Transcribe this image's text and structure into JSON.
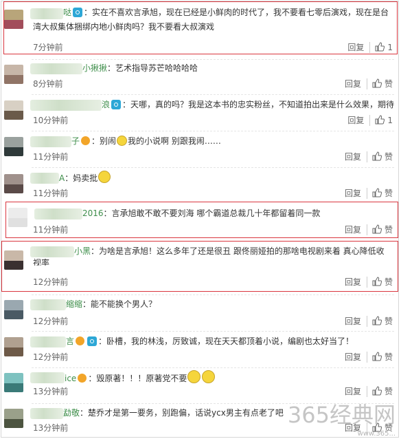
{
  "actions": {
    "reply": "回复",
    "like": "赞"
  },
  "comments": [
    {
      "name": "哒",
      "text": "：实在不喜欢言承旭，现在已经是小鲜肉的时代了，我不要看七零后演戏，现在是台",
      "text2": "湾大叔集体捆绑内地小鲜肉吗？我不要看大叔演戏",
      "time": "7分钟前",
      "likes": "1"
    },
    {
      "name": "小揪揪",
      "text": "：艺术指导苏芒哈哈哈哈",
      "time": "8分钟前",
      "likes": "赞"
    },
    {
      "name": "浪",
      "text": "：天哪，真的吗？我是这本书的忠实粉丝，不知道拍出来是什么效果，期待",
      "time": "10分钟前",
      "likes": "1"
    },
    {
      "name": "子",
      "text": "：别闹",
      "text_b": "我的小说啊 别跟我闹……",
      "time": "11分钟前",
      "likes": "赞"
    },
    {
      "name": "A",
      "text": "：妈卖批",
      "time": "11分钟前",
      "likes": "赞"
    },
    {
      "name": "2016",
      "text": "：言承旭敢不敢不要刘海 哪个霸道总裁几十年都留着同一款",
      "time": "11分钟前",
      "likes": "赞"
    },
    {
      "name": "小黑",
      "text": "：为啥是言承旭！这么多年了还是很丑 跟佟丽娅拍的那啥电视剧来着 真心降低收",
      "text2": "视率",
      "time": "12分钟前",
      "likes": "赞"
    },
    {
      "name": "缩缩",
      "text": "：能不能换个男人？",
      "time": "12分钟前",
      "likes": "赞"
    },
    {
      "name": "言",
      "text": "：卧槽，我的林浅，厉致诚，现在天天都顶着小说，编剧也太好当了！",
      "time": "12分钟前",
      "likes": "赞"
    },
    {
      "name": "ice",
      "text": "：毁原著！！！原著党不要",
      "time": "13分钟前",
      "likes": "赞"
    },
    {
      "name": "勐敬",
      "text": "：楚乔才是第一要务，别跑偏，话说ycx男主有点老了吧",
      "time": "13分钟前",
      "likes": "赞"
    }
  ],
  "watermark": {
    "text": "365经典网",
    "url": "www.365..."
  }
}
